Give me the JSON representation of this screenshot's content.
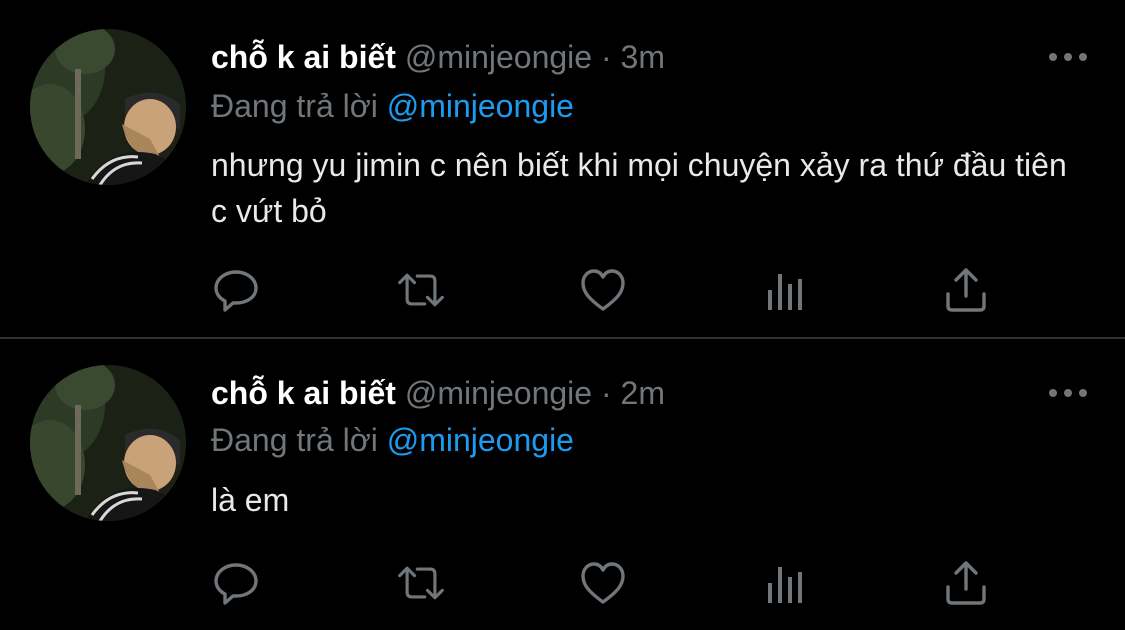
{
  "colors": {
    "background": "#000000",
    "primary_text": "#e7e9ea",
    "secondary_text": "#71767b",
    "accent": "#1d9bf0",
    "divider": "#2f3336"
  },
  "tweets": [
    {
      "display_name": "chỗ k ai biết",
      "handle": "@minjeongie",
      "separator": "·",
      "time": "3m",
      "reply_prefix": "Đang trả lời",
      "reply_to": "@minjeongie",
      "text": "nhưng yu jimin c nên biết khi mọi chuyện xảy ra thứ đầu tiên c vứt bỏ",
      "icons": [
        "reply-icon",
        "retweet-icon",
        "like-icon",
        "views-icon",
        "share-icon"
      ]
    },
    {
      "display_name": "chỗ k ai biết",
      "handle": "@minjeongie",
      "separator": "·",
      "time": "2m",
      "reply_prefix": "Đang trả lời",
      "reply_to": "@minjeongie",
      "text": "là em",
      "icons": [
        "reply-icon",
        "retweet-icon",
        "like-icon",
        "views-icon",
        "share-icon"
      ]
    }
  ]
}
